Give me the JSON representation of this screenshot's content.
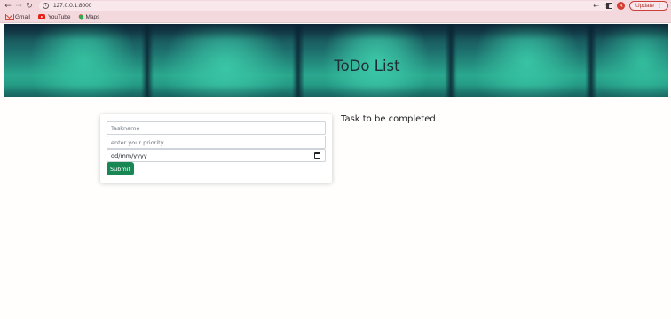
{
  "browser": {
    "url": "127.0.0.1:8000",
    "avatar_letter": "A",
    "update_label": "Update",
    "bookmarks": [
      {
        "label": "Gmail",
        "icon": "gmail-icon"
      },
      {
        "label": "YouTube",
        "icon": "youtube-icon"
      },
      {
        "label": "Maps",
        "icon": "maps-icon"
      }
    ]
  },
  "hero": {
    "title": "ToDo List"
  },
  "form": {
    "taskname_placeholder": "Taskname",
    "priority_placeholder": "enter your priority",
    "date_placeholder": "dd/mm/yyyy",
    "submit_label": "Submit"
  },
  "tasks": {
    "heading": "Task to be completed"
  },
  "colors": {
    "accent": "#198754",
    "chrome": "#f3d9dd",
    "hero_teal": "#2aa88e"
  }
}
